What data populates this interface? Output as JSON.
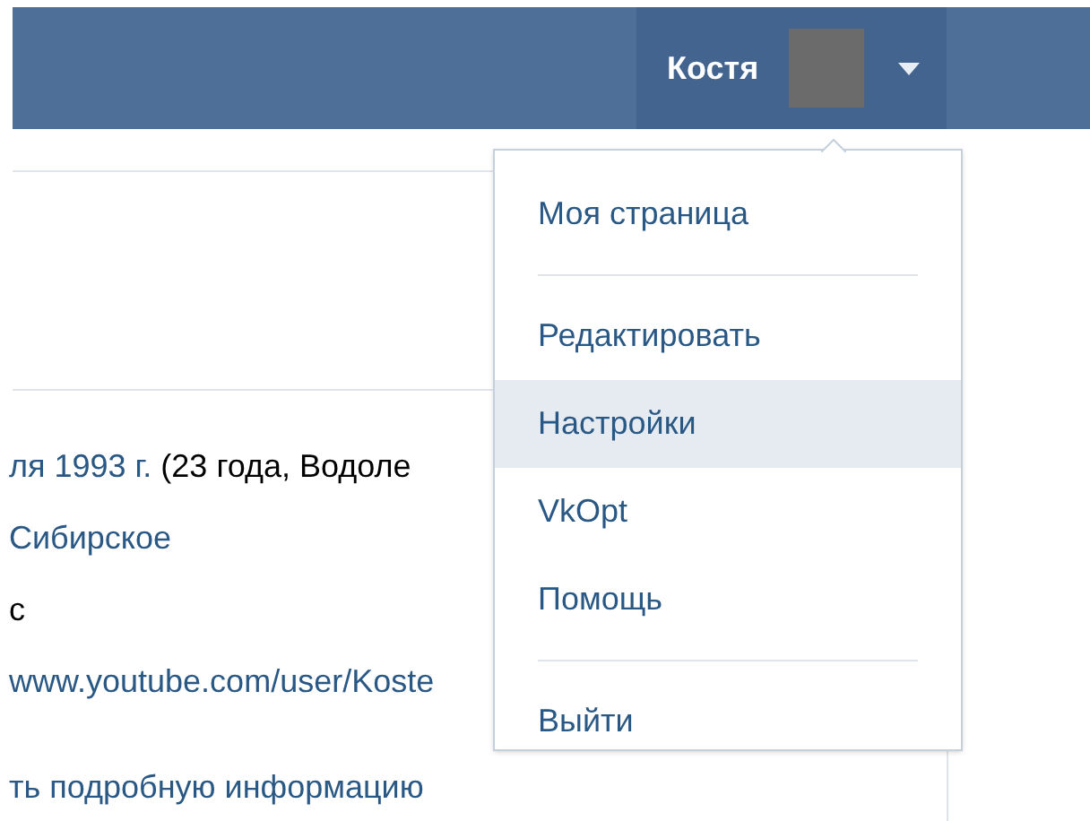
{
  "header": {
    "user_name": "Костя"
  },
  "profile": {
    "rows": [
      {
        "parts": [
          {
            "text": "ля 1993 г.",
            "link": true
          },
          {
            "text": " (23 года, Водоле",
            "link": false
          }
        ]
      },
      {
        "parts": [
          {
            "text": "Сибирское",
            "link": true
          }
        ]
      },
      {
        "parts": [
          {
            "text": "с",
            "link": false
          }
        ]
      },
      {
        "parts": [
          {
            "text": "www.youtube.com/user/Koste",
            "link": true
          }
        ]
      }
    ],
    "more_link": "ть подробную информацию"
  },
  "menu": {
    "groups": [
      [
        {
          "label": "Моя страница",
          "selected": false
        }
      ],
      [
        {
          "label": "Редактировать",
          "selected": false
        },
        {
          "label": "Настройки",
          "selected": true
        },
        {
          "label": "VkOpt",
          "selected": false
        },
        {
          "label": "Помощь",
          "selected": false
        }
      ],
      [
        {
          "label": "Выйти",
          "selected": false
        }
      ]
    ]
  }
}
